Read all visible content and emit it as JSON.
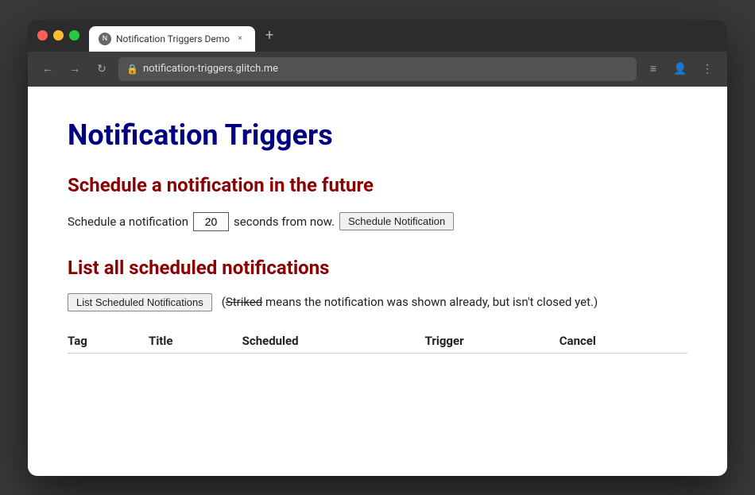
{
  "window": {
    "title": "Notification Triggers Demo",
    "url": "notification-triggers.glitch.me"
  },
  "traffic_lights": {
    "close_label": "×",
    "minimize_label": "−",
    "maximize_label": "+"
  },
  "tab": {
    "label": "Notification Triggers Demo",
    "close": "×",
    "new_tab": "+"
  },
  "nav": {
    "back": "←",
    "forward": "→",
    "reload": "↻",
    "lock": "🔒",
    "menu_icon": "≡",
    "account_icon": "👤",
    "more_icon": "⋮"
  },
  "page": {
    "title": "Notification Triggers",
    "section1_title": "Schedule a notification in the future",
    "schedule_label_before": "Schedule a notification",
    "schedule_seconds_value": "20",
    "schedule_label_after": "seconds from now.",
    "schedule_btn": "Schedule Notification",
    "section2_title": "List all scheduled notifications",
    "list_btn": "List Scheduled Notifications",
    "striked_note_prefix": "(",
    "striked_word": "Striked",
    "striked_note_suffix": " means the notification was shown already, but isn't closed yet.)",
    "table": {
      "columns": [
        "Tag",
        "Title",
        "Scheduled",
        "Trigger",
        "Cancel"
      ],
      "rows": []
    }
  }
}
